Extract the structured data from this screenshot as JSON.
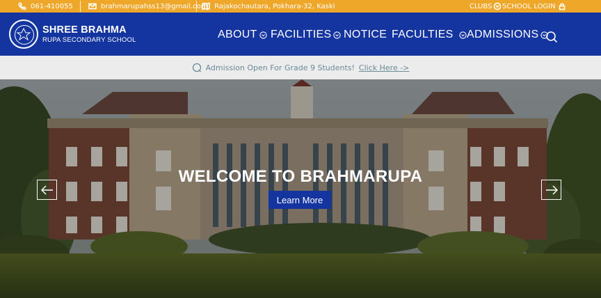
{
  "topbar": {
    "phone": "061-410055",
    "email": "brahmarupahss13@gmail.com",
    "address": "Rajakochautara, Pokhara-32, Kaski",
    "clubs": "CLUBS",
    "login": "SCHOOL LOGIN"
  },
  "brand": {
    "name_line1": "SHREE BRAHMA",
    "name_line2": "RUPA SECONDARY SCHOOL"
  },
  "nav": {
    "about": "ABOUT",
    "facilities": "FACILITIES",
    "notice": "NOTICE",
    "faculties": "FACULTIES",
    "admissions": "ADMISSIONS"
  },
  "announcement": {
    "text": "Admission Open For Grade 9 Students!",
    "link": "Click Here ->"
  },
  "hero": {
    "title": "WELCOME TO BRAHMARUPA",
    "button": "Learn More"
  },
  "colors": {
    "topbar": "#efa72a",
    "navbar": "#1435a0",
    "button": "#1435a0"
  }
}
